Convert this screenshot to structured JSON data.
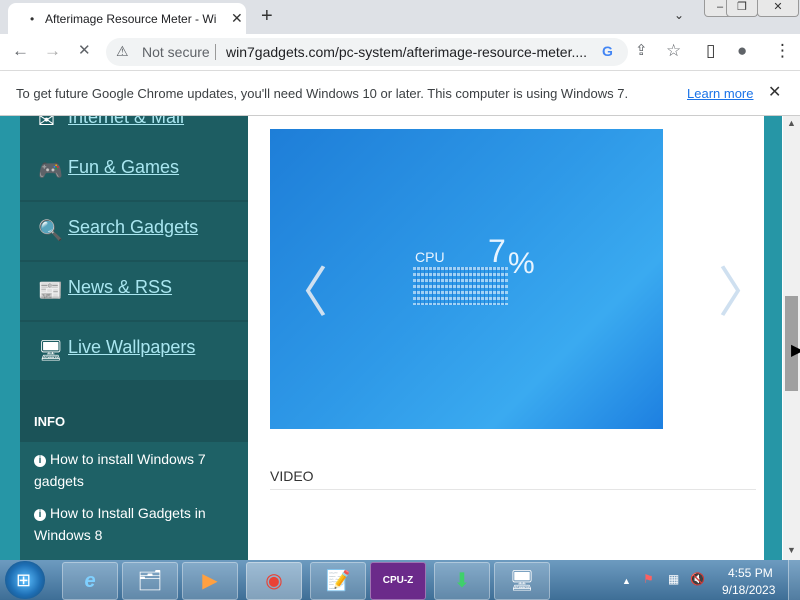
{
  "browser": {
    "tab_title": "Afterimage Resource Meter - Wi",
    "tab_loading_dot": "•",
    "close_symbol": "✕",
    "new_tab_symbol": "+",
    "tab_menu_symbol": "⌄",
    "window_buttons": {
      "minimize": "–",
      "restore": "❐",
      "close": "✕"
    }
  },
  "toolbar": {
    "back": "←",
    "forward": "→",
    "stop": "✕",
    "security_icon": "⚠",
    "security_text": "Not secure",
    "url": "win7gadgets.com/pc-system/afterimage-resource-meter....",
    "google_icon": "G",
    "share_icon": "⇪",
    "star_icon": "☆",
    "sidepanel_icon": "▯",
    "profile_icon": "●",
    "menu_icon": "⋮"
  },
  "infobar": {
    "message": "To get future Google Chrome updates, you'll need Windows 10 or later. This computer is using Windows 7.",
    "link": "Learn more",
    "close": "✕"
  },
  "sidebar": {
    "items": [
      {
        "label": "Internet & Mail",
        "icon": "✉"
      },
      {
        "label": "Fun & Games",
        "icon": "🎮"
      },
      {
        "label": "Search Gadgets",
        "icon": "🔍"
      },
      {
        "label": "News & RSS",
        "icon": "📰"
      },
      {
        "label": "Live Wallpapers",
        "icon": "🖥"
      }
    ],
    "info_heading": "INFO",
    "info_links": [
      {
        "label": "How to install Windows 7 gadgets"
      },
      {
        "label": "How to Install Gadgets in Windows 8"
      }
    ],
    "info_icon": "i"
  },
  "main": {
    "slider": {
      "prev": "〈",
      "next": "〉",
      "cpu_label": "CPU",
      "cpu_value": "7",
      "cpu_unit": "%"
    },
    "video_heading": "VIDEO"
  },
  "scrollbar": {
    "up": "▲",
    "down": "▼"
  },
  "taskbar": {
    "start_icon": "⊞",
    "apps": [
      {
        "name": "internet-explorer",
        "glyph": "e"
      },
      {
        "name": "file-explorer",
        "glyph": "🗂"
      },
      {
        "name": "media-player",
        "glyph": "▶"
      },
      {
        "name": "chrome",
        "glyph": "◉"
      },
      {
        "name": "notepad",
        "glyph": "📝"
      },
      {
        "name": "cpu-z",
        "glyph": "CPU-Z"
      },
      {
        "name": "installer",
        "glyph": "⬇"
      },
      {
        "name": "remote-desktop",
        "glyph": "🖥"
      }
    ],
    "tray": {
      "arrow": "▲",
      "flag": "⚑",
      "network": "▦",
      "volume": "🔇"
    },
    "time": "4:55 PM",
    "date": "9/18/2023"
  }
}
